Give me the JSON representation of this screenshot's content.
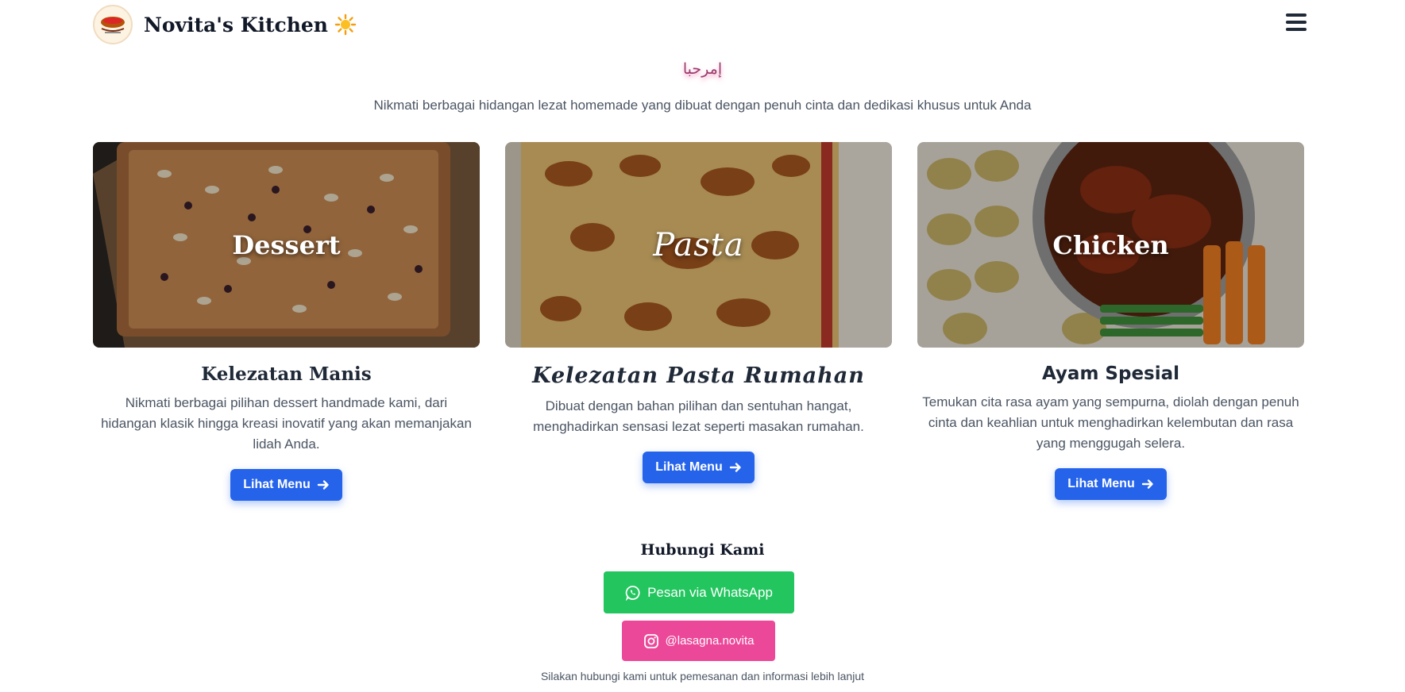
{
  "header": {
    "brand_title": "Novita's Kitchen",
    "brand_icon": "sun-icon",
    "menu_icon": "hamburger-menu-icon"
  },
  "hero": {
    "welcome": "إمرحبا",
    "tagline": "Nikmati berbagai hidangan lezat homemade yang dibuat dengan penuh cinta dan dedikasi khusus untuk Anda"
  },
  "cards": [
    {
      "image_label": "Dessert",
      "title": "Kelezatan Manis",
      "description": "Nikmati berbagai pilihan dessert handmade kami, dari hidangan klasik hingga kreasi inovatif yang akan memanjakan lidah Anda.",
      "button_label": "Lihat Menu"
    },
    {
      "image_label": "Pasta",
      "title": "Kelezatan Pasta Rumahan",
      "description": "Dibuat dengan bahan pilihan dan sentuhan hangat, menghadirkan sensasi lezat seperti masakan rumahan.",
      "button_label": "Lihat Menu"
    },
    {
      "image_label": "Chicken",
      "title": "Ayam Spesial",
      "description": "Temukan cita rasa ayam yang sempurna, diolah dengan penuh cinta dan keahlian untuk menghadirkan kelembutan dan rasa yang menggugah selera.",
      "button_label": "Lihat Menu"
    }
  ],
  "contact": {
    "title": "Hubungi Kami",
    "whatsapp_label": "Pesan via WhatsApp",
    "instagram_label": "@lasagna.novita",
    "note": "Silakan hubungi kami untuk pemesanan dan informasi lebih lanjut"
  },
  "colors": {
    "primary_button": "#2563eb",
    "whatsapp": "#22c55e",
    "instagram": "#ec4899"
  }
}
